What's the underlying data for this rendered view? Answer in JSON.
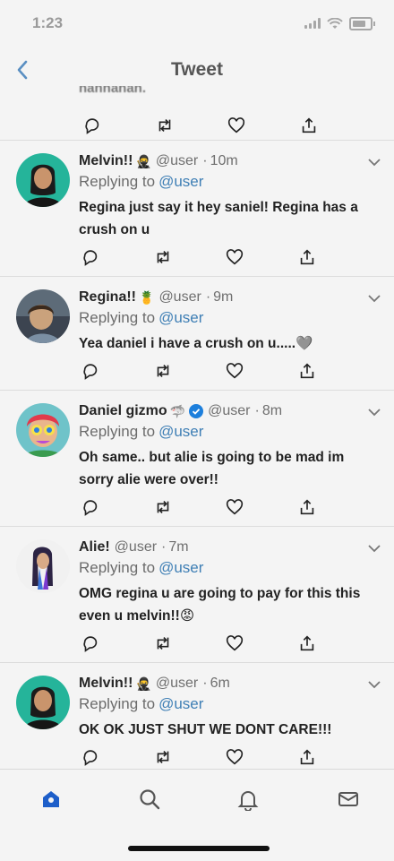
{
  "status_bar": {
    "time": "1:23",
    "icons": [
      "signal-icon",
      "wifi-icon",
      "battery-icon"
    ]
  },
  "nav": {
    "back_icon": "back-arrow-icon",
    "title": "Tweet"
  },
  "clipped_tweet": {
    "text": "hahhahah."
  },
  "tweets": [
    {
      "name": "Melvin!!",
      "emoji": "🥷",
      "handle": "@user",
      "time": "10m",
      "replying_label": "Replying to",
      "replying_to": "@user",
      "text": "Regina just say it hey saniel! Regina has a crush on u",
      "avatar": "avatar-melvin"
    },
    {
      "name": "Regina!!",
      "emoji": "🍍",
      "handle": "@user",
      "time": "9m",
      "replying_label": "Replying to",
      "replying_to": "@user",
      "text": "Yea daniel i have a crush  on u.....🩶",
      "avatar": "avatar-regina"
    },
    {
      "name": "Daniel gizmo",
      "emoji": "🦈",
      "verified": true,
      "handle": "@user",
      "time": "8m",
      "replying_label": "Replying to",
      "replying_to": "@user",
      "text": "Oh same.. but alie is going to be mad im sorry alie were over!!",
      "avatar": "avatar-daniel"
    },
    {
      "name": "Alie!",
      "emoji": "",
      "handle": "@user",
      "time": "7m",
      "replying_label": "Replying to",
      "replying_to": "@user",
      "text": "OMG regina u  are going to pay for this this even u melvin!!😡",
      "avatar": "avatar-alie"
    },
    {
      "name": "Melvin!!",
      "emoji": "🥷",
      "handle": "@user",
      "time": "6m",
      "replying_label": "Replying to",
      "replying_to": "@user",
      "text": "OK OK JUST SHUT WE DONT CARE!!!",
      "avatar": "avatar-melvin"
    }
  ],
  "tab_bar": {
    "items": [
      "home-icon",
      "search-icon",
      "notifications-icon",
      "messages-icon"
    ]
  },
  "colors": {
    "background": "#f4f4f4",
    "accent": "#3f7fb5",
    "home_active": "#1d5ec9"
  }
}
